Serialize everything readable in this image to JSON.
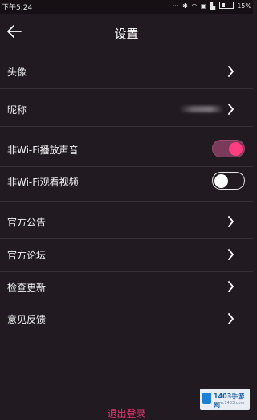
{
  "status_bar": {
    "time": "下午5:24",
    "battery_text": "15%"
  },
  "header": {
    "title": "设置"
  },
  "settings": {
    "avatar_label": "头像",
    "nickname_label": "昵称",
    "wifi_sound_label": "非Wi-Fi播放声音",
    "wifi_sound_on": true,
    "wifi_video_label": "非Wi-Fi观看视频",
    "wifi_video_on": false,
    "announcement_label": "官方公告",
    "forum_label": "官方论坛",
    "update_label": "检查更新",
    "feedback_label": "意见反馈"
  },
  "logout_label": "退出登录",
  "watermark": {
    "text": "1403手游网",
    "sub": "www.1403.com"
  },
  "colors": {
    "background": "#221a21",
    "accent": "#ff3d7f",
    "logout": "#e8356f"
  }
}
